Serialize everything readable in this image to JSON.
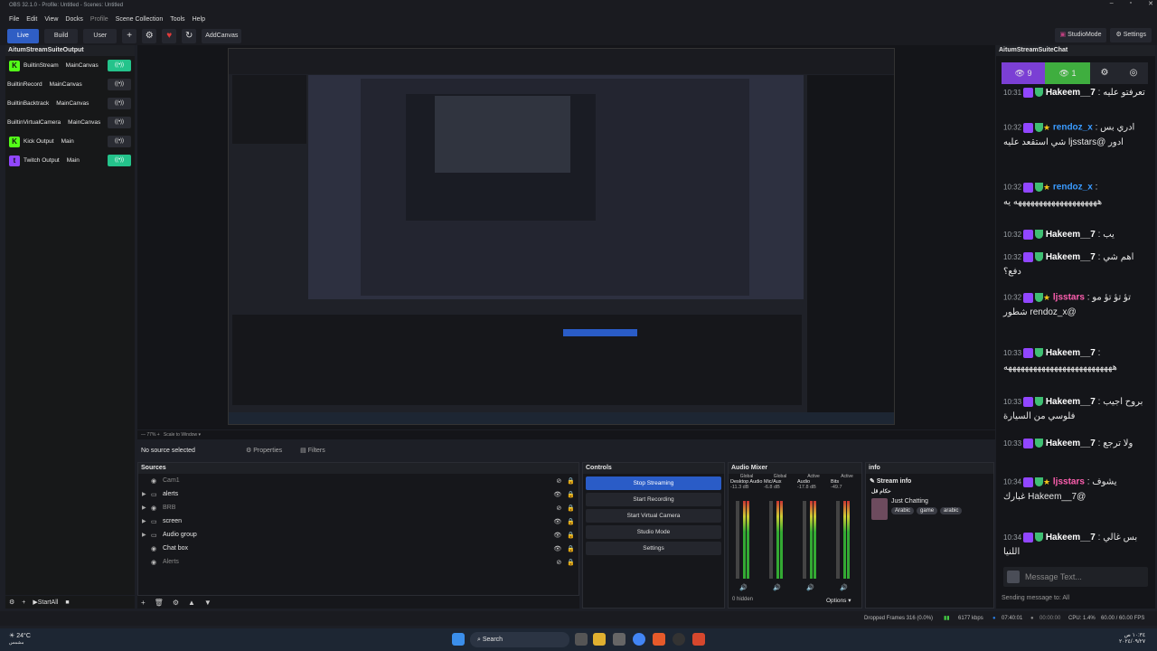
{
  "window": {
    "title": "OBS 32.1.0 - Profile: Untitled - Scenes: Untitled"
  },
  "menu": [
    "File",
    "Edit",
    "View",
    "Docks",
    "Profile",
    "Scene Collection",
    "Tools",
    "Help"
  ],
  "toolbar": {
    "live": "Live",
    "build": "Build",
    "user": "User",
    "add_canvas": "AddCanvas",
    "studio_mode": "StudioMode",
    "settings": "Settings"
  },
  "outputs": {
    "title": "AitumStreamSuiteOutput",
    "rows": [
      {
        "name": "BuiltinStream",
        "canvas": "MainCanvas",
        "icon": "K",
        "icon_color": "#53fc18",
        "on": true
      },
      {
        "name": "BuiltinRecord",
        "canvas": "MainCanvas",
        "icon": "",
        "icon_color": "",
        "on": false
      },
      {
        "name": "BuiltinBacktrack",
        "canvas": "MainCanvas",
        "icon": "",
        "icon_color": "",
        "on": false
      },
      {
        "name": "BuiltinVirtualCamera",
        "canvas": "MainCanvas",
        "icon": "",
        "icon_color": "",
        "on": false
      },
      {
        "name": "Kick Output",
        "canvas": "Main",
        "icon": "K",
        "icon_color": "#53fc18",
        "on": false
      },
      {
        "name": "Twitch Output",
        "canvas": "Main",
        "icon": "t",
        "icon_color": "#9146ff",
        "on": true
      }
    ],
    "start_all": "StartAll"
  },
  "preview": {
    "zoom": "77%",
    "scale": "Scale to Window"
  },
  "selection": {
    "no_source": "No source selected",
    "properties": "Properties",
    "filters": "Filters"
  },
  "sources": {
    "title": "Sources",
    "rows": [
      {
        "label": "Cam1",
        "dim": true,
        "folder": false,
        "arrow": false
      },
      {
        "label": "alerts",
        "dim": false,
        "folder": true,
        "arrow": true
      },
      {
        "label": "BRB",
        "dim": true,
        "folder": false,
        "arrow": true
      },
      {
        "label": "screen",
        "dim": false,
        "folder": true,
        "arrow": true
      },
      {
        "label": "Audio group",
        "dim": false,
        "folder": true,
        "arrow": true
      },
      {
        "label": "Chat box",
        "dim": false,
        "folder": false,
        "arrow": false
      },
      {
        "label": "Alerts",
        "dim": true,
        "folder": false,
        "arrow": false
      }
    ]
  },
  "controls": {
    "title": "Controls",
    "buttons": [
      "Stop Streaming",
      "Start Recording",
      "Start Virtual Camera",
      "Studio Mode",
      "Settings"
    ]
  },
  "mixer": {
    "title": "Audio Mixer",
    "channels": [
      {
        "group": "Global",
        "name": "Desktop Audio",
        "db": "-11.3 dB"
      },
      {
        "group": "Global",
        "name": "Mic/Aux",
        "db": "-6.8 dB"
      },
      {
        "group": "Active",
        "name": "Audio",
        "db": "-17.8 dB"
      },
      {
        "group": "Active",
        "name": "Bits",
        "db": "-49.7"
      }
    ],
    "hidden": "0 hidden",
    "options": "Options"
  },
  "info": {
    "title": "info",
    "stream_info": "Stream info",
    "channel": "حكام قل",
    "category": "Just Chatting",
    "tags": [
      "Arabic",
      "game",
      "arabic"
    ]
  },
  "chat": {
    "title": "AitumStreamSuiteChat",
    "viewers_twitch": "9",
    "viewers_kick": "1",
    "messages": [
      {
        "ts": "10:31",
        "user": "Hakeem__7",
        "text": "تعرفتو عليه"
      },
      {
        "ts": "10:32",
        "user": "rendoz_x",
        "text": "ادري بس ادور @ljsstars شي استقعد عليه"
      },
      {
        "ts": "10:32",
        "user": "rendoz_x",
        "text": "ههههههههههههههههههههه يه"
      },
      {
        "ts": "10:32",
        "user": "Hakeem__7",
        "text": "يب"
      },
      {
        "ts": "10:32",
        "user": "Hakeem__7",
        "text": "اهم شي دفع؟"
      },
      {
        "ts": "10:32",
        "user": "ljsstars",
        "text": "تؤ تؤ تؤ مو @rendoz_x شطور"
      },
      {
        "ts": "10:33",
        "user": "Hakeem__7",
        "text": "ههههههههههههههههههههههههههه"
      },
      {
        "ts": "10:33",
        "user": "Hakeem__7",
        "text": "بروح اجيب فلوسي من السيارة"
      },
      {
        "ts": "10:33",
        "user": "Hakeem__7",
        "text": "ولا ترجع"
      },
      {
        "ts": "10:34",
        "user": "ljsstars",
        "text": "يشوف @Hakeem__7 غبارك"
      },
      {
        "ts": "10:34",
        "user": "Hakeem__7",
        "text": "بس غالي اللنيا"
      }
    ],
    "input_placeholder": "Message Text...",
    "sending_to": "Sending message to: All"
  },
  "status": {
    "dropped": "Dropped Frames 316 (0.0%)",
    "bitrate": "6177 kbps",
    "live_time": "07:40:01",
    "rec_time": "00:00:00",
    "cpu": "CPU: 1.4%",
    "fps": "60.00 / 60.00 FPS"
  },
  "taskbar": {
    "weather": "24°C",
    "weather_sub": "مشمس",
    "search": "Search",
    "time": "١٠:٣٤ ص",
    "date": "٢٠٢٤/٠٩/٢٧"
  }
}
